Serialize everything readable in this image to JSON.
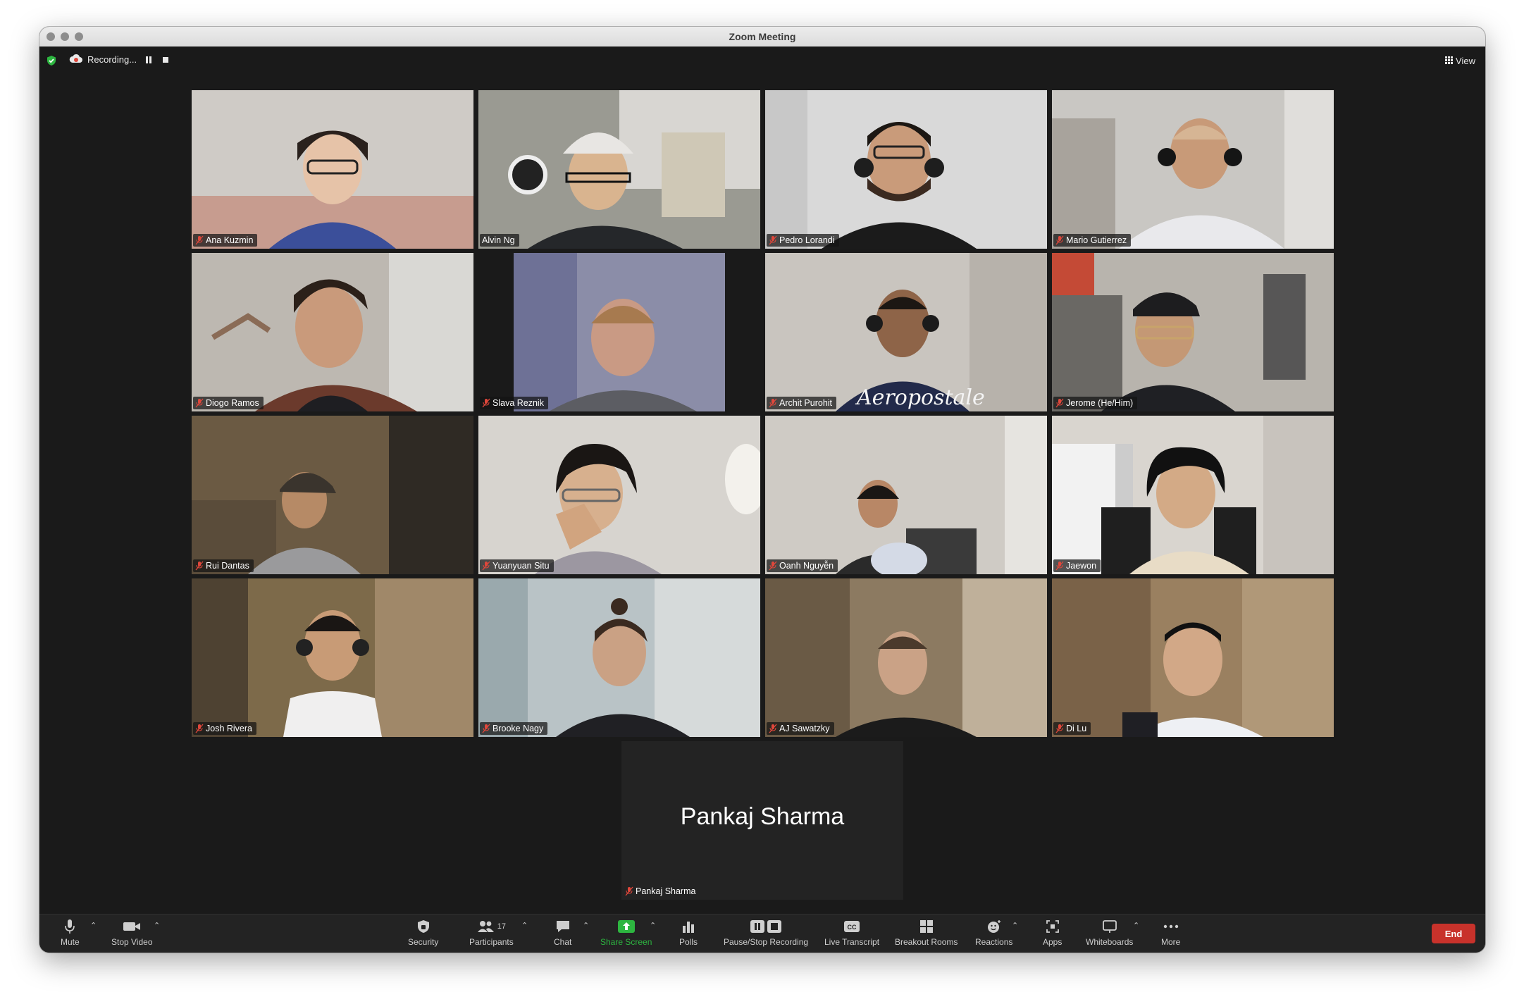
{
  "window": {
    "title": "Zoom Meeting"
  },
  "topbar": {
    "recording_label": "Recording...",
    "view_label": "View"
  },
  "participants": [
    {
      "name": "Ana Kuzmin",
      "muted": true
    },
    {
      "name": "Alvin Ng",
      "muted": false
    },
    {
      "name": "Pedro Lorandi",
      "muted": true
    },
    {
      "name": "Mario Gutierrez",
      "muted": true
    },
    {
      "name": "Diogo Ramos",
      "muted": true,
      "active_speaker": true
    },
    {
      "name": "Slava Reznik",
      "muted": true
    },
    {
      "name": "Archit Purohit",
      "muted": true
    },
    {
      "name": "Jerome (He/Him)",
      "muted": true
    },
    {
      "name": "Rui Dantas",
      "muted": true
    },
    {
      "name": "Yuanyuan Situ",
      "muted": true
    },
    {
      "name": "Oanh Nguyễn",
      "muted": true
    },
    {
      "name": "Jaewon",
      "muted": true
    },
    {
      "name": "Josh Rivera",
      "muted": true
    },
    {
      "name": "Brooke Nagy",
      "muted": true
    },
    {
      "name": "AJ Sawatzky",
      "muted": true
    },
    {
      "name": "Di Lu",
      "muted": true
    }
  ],
  "video_off_tile": {
    "display_name": "Pankaj Sharma",
    "name_tag": "Pankaj Sharma"
  },
  "toolbar": {
    "mute": "Mute",
    "stop_video": "Stop Video",
    "security": "Security",
    "participants": "Participants",
    "participant_count": "17",
    "chat": "Chat",
    "share_screen": "Share Screen",
    "polls": "Polls",
    "pause_stop_recording": "Pause/Stop Recording",
    "live_transcript": "Live Transcript",
    "breakout_rooms": "Breakout Rooms",
    "reactions": "Reactions",
    "apps": "Apps",
    "whiteboards": "Whiteboards",
    "more": "More",
    "end": "End"
  },
  "colors": {
    "active_speaker_border": "#2db640",
    "share_screen_green": "#2db640",
    "end_button": "#c8322b",
    "muted_mic": "#e0473b"
  },
  "icons": [
    "shield-check-icon",
    "recording-cloud-icon",
    "pause-icon",
    "stop-icon",
    "grid-view-icon",
    "microphone-icon",
    "video-camera-icon",
    "shield-icon",
    "participants-icon",
    "chat-bubble-icon",
    "share-screen-arrow-icon",
    "polls-bar-icon",
    "record-pause-stop-icon",
    "closed-caption-icon",
    "breakout-rooms-icon",
    "reactions-emoji-icon",
    "apps-icon",
    "whiteboard-icon",
    "more-dots-icon",
    "muted-mic-icon"
  ]
}
